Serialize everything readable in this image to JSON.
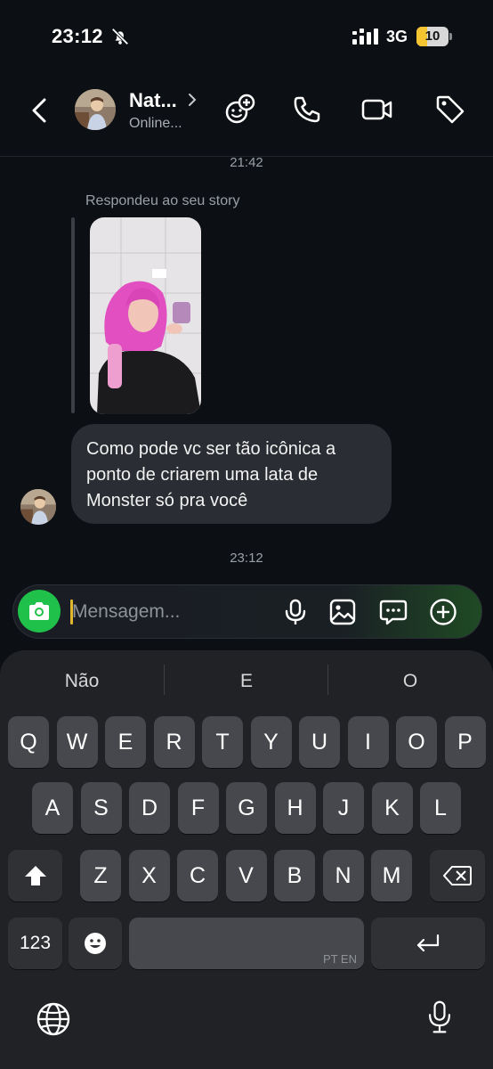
{
  "status_bar": {
    "time": "23:12",
    "network": "3G",
    "battery": "10",
    "battery_fraction": 0.1
  },
  "header": {
    "name": "Nat...",
    "status": "Online..."
  },
  "chat": {
    "timestamp_top": "21:42",
    "reply_label": "Respondeu ao seu story",
    "message": "Como pode vc ser tão icônica a ponto de criarem uma lata de Monster só pra você",
    "timestamp_bottom": "23:12"
  },
  "composer": {
    "placeholder": "Mensagem..."
  },
  "keyboard": {
    "suggestions": [
      "Não",
      "E",
      "O"
    ],
    "row1": [
      "Q",
      "W",
      "E",
      "R",
      "T",
      "Y",
      "U",
      "I",
      "O",
      "P"
    ],
    "row2": [
      "A",
      "S",
      "D",
      "F",
      "G",
      "H",
      "J",
      "K",
      "L"
    ],
    "row3": [
      "Z",
      "X",
      "C",
      "V",
      "B",
      "N",
      "M"
    ],
    "numbers_key": "123",
    "space_hint": "PT EN"
  },
  "icons": {
    "back": "chevron-left-icon",
    "add_member": "add-member-icon",
    "call": "phone-icon",
    "video": "video-camera-icon",
    "tag": "tag-icon",
    "camera": "camera-icon",
    "mic": "microphone-icon",
    "image": "image-icon",
    "chat": "chat-bubble-icon",
    "plus": "plus-circle-icon"
  },
  "colors": {
    "accent_green": "#1fc14a",
    "background": "#0c0f14",
    "bubble": "#2a2d33",
    "battery_yellow": "#f5c531"
  }
}
